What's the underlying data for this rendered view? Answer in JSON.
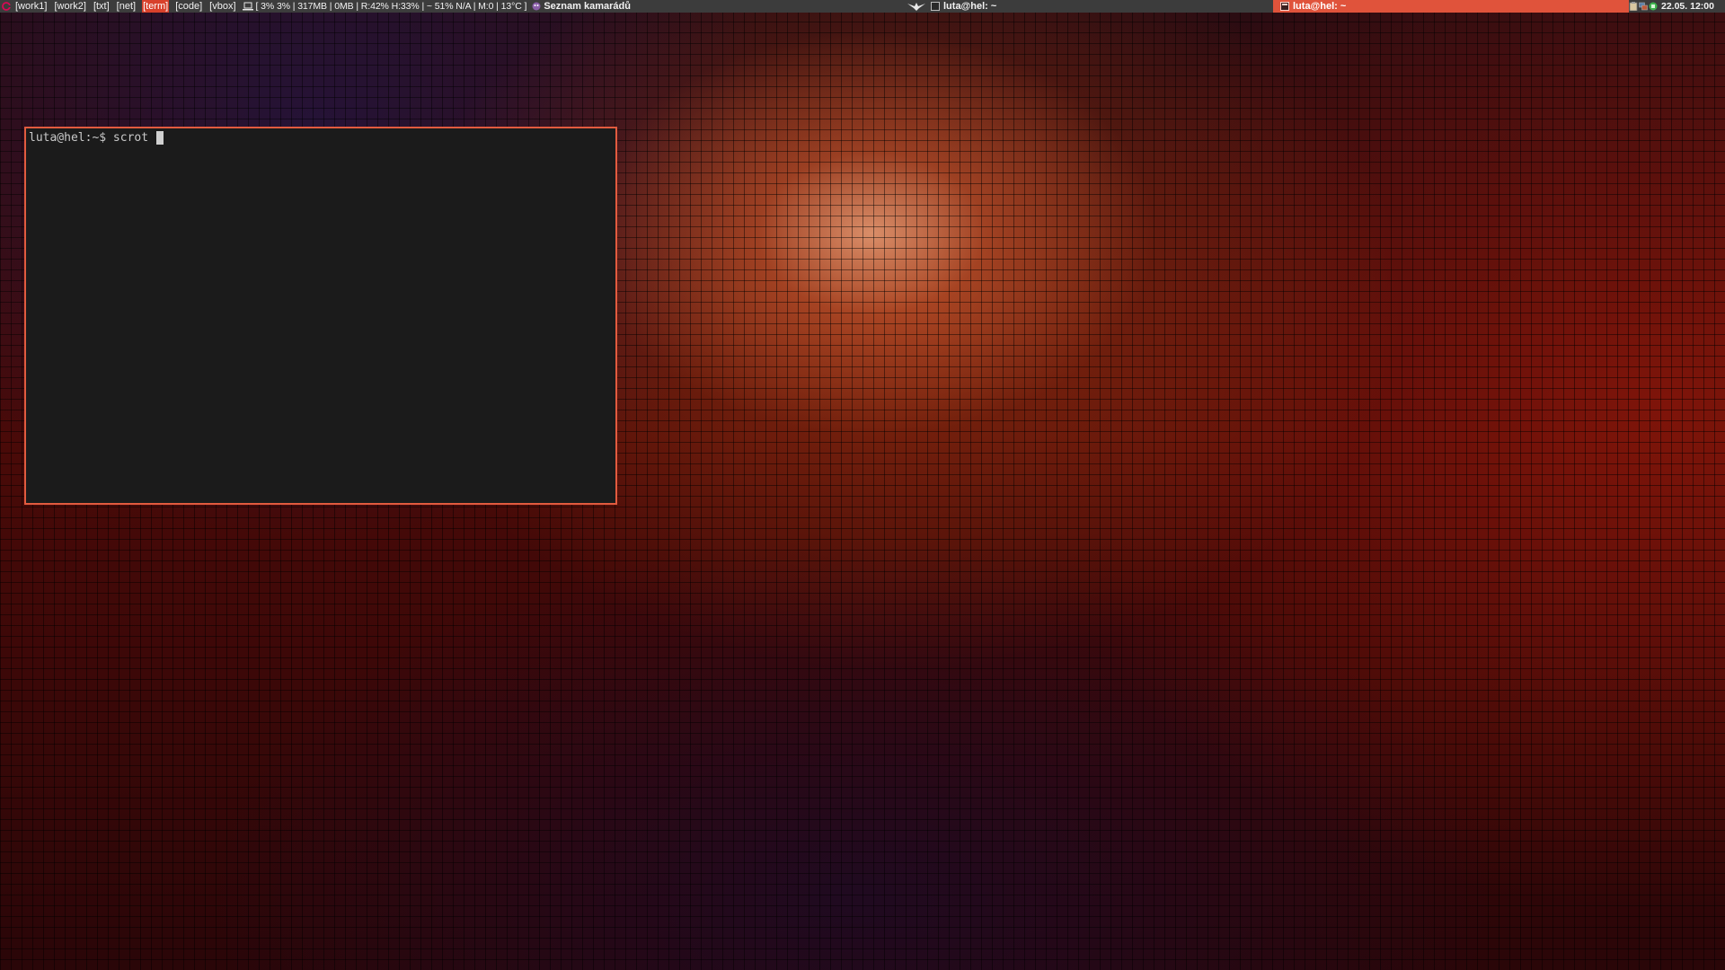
{
  "panel": {
    "workspaces": [
      {
        "label": "[work1]",
        "active": false
      },
      {
        "label": "[work2]",
        "active": false
      },
      {
        "label": "[txt]",
        "active": false
      },
      {
        "label": "[net]",
        "active": false
      },
      {
        "label": "[term]",
        "active": true
      },
      {
        "label": "[code]",
        "active": false
      },
      {
        "label": "[vbox]",
        "active": false
      }
    ],
    "system_stats": "[ 3% 3% | 317MB | 0MB | R:42% H:33% | ~ 51%  N/A | M:0 | 13°C ]",
    "buddy_list_title": "Seznam kamarádů",
    "center_window_title": "luta@hel: ~",
    "active_window_title": "luta@hel: ~",
    "clock": "22.05. 12:00",
    "accent_color": "#e0533b"
  },
  "terminal": {
    "prompt": "luta@hel:~$ ",
    "command": "scrot ",
    "border_color": "#e25b3f",
    "background": "#1b1b1b"
  },
  "icons": {
    "panel_logo": "debian-swirl-icon",
    "stats_icon": "laptop-icon",
    "buddy_icon": "pidgin-icon",
    "center_icon": "bird-icon",
    "window_icon": "terminal-icon",
    "tray": [
      "clipboard-icon",
      "network-icon",
      "battery-icon"
    ]
  }
}
